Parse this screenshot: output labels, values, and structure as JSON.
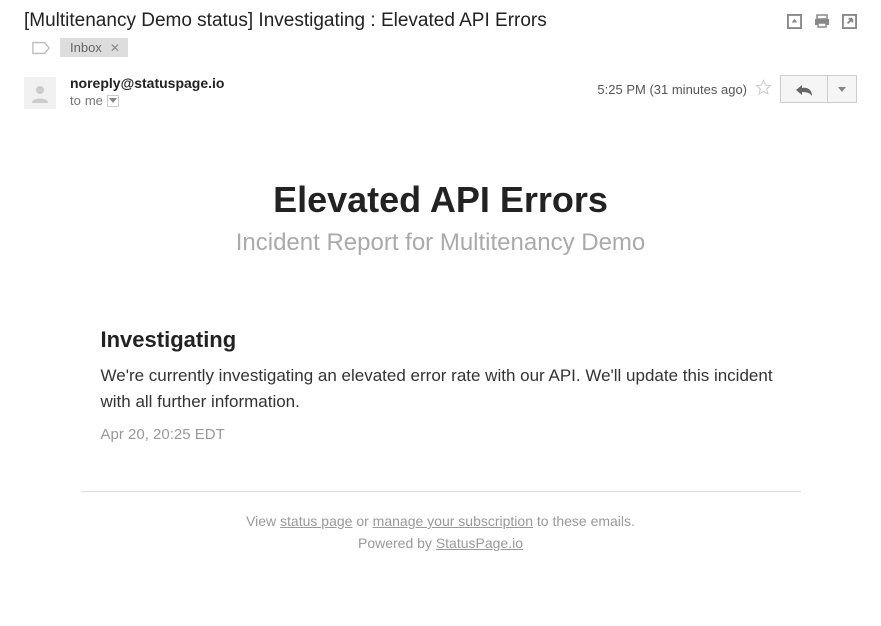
{
  "header": {
    "subject": "[Multitenancy Demo status] Investigating : Elevated API Errors",
    "label_chip": "Inbox"
  },
  "sender": {
    "email": "noreply@statuspage.io",
    "recipient_prefix": "to",
    "recipient": "me",
    "timestamp": "5:25 PM (31 minutes ago)"
  },
  "body": {
    "title": "Elevated API Errors",
    "subtitle": "Incident Report for Multitenancy Demo",
    "section_heading": "Investigating",
    "section_text": "We're currently investigating an elevated error rate with our API. We'll update this incident with all further information.",
    "section_time": "Apr 20, 20:25 EDT"
  },
  "footer": {
    "prefix": "View ",
    "link1": "status page",
    "mid": " or ",
    "link2": "manage your subscription",
    "suffix": " to these emails.",
    "powered_prefix": "Powered by ",
    "powered_link": "StatusPage.io"
  }
}
